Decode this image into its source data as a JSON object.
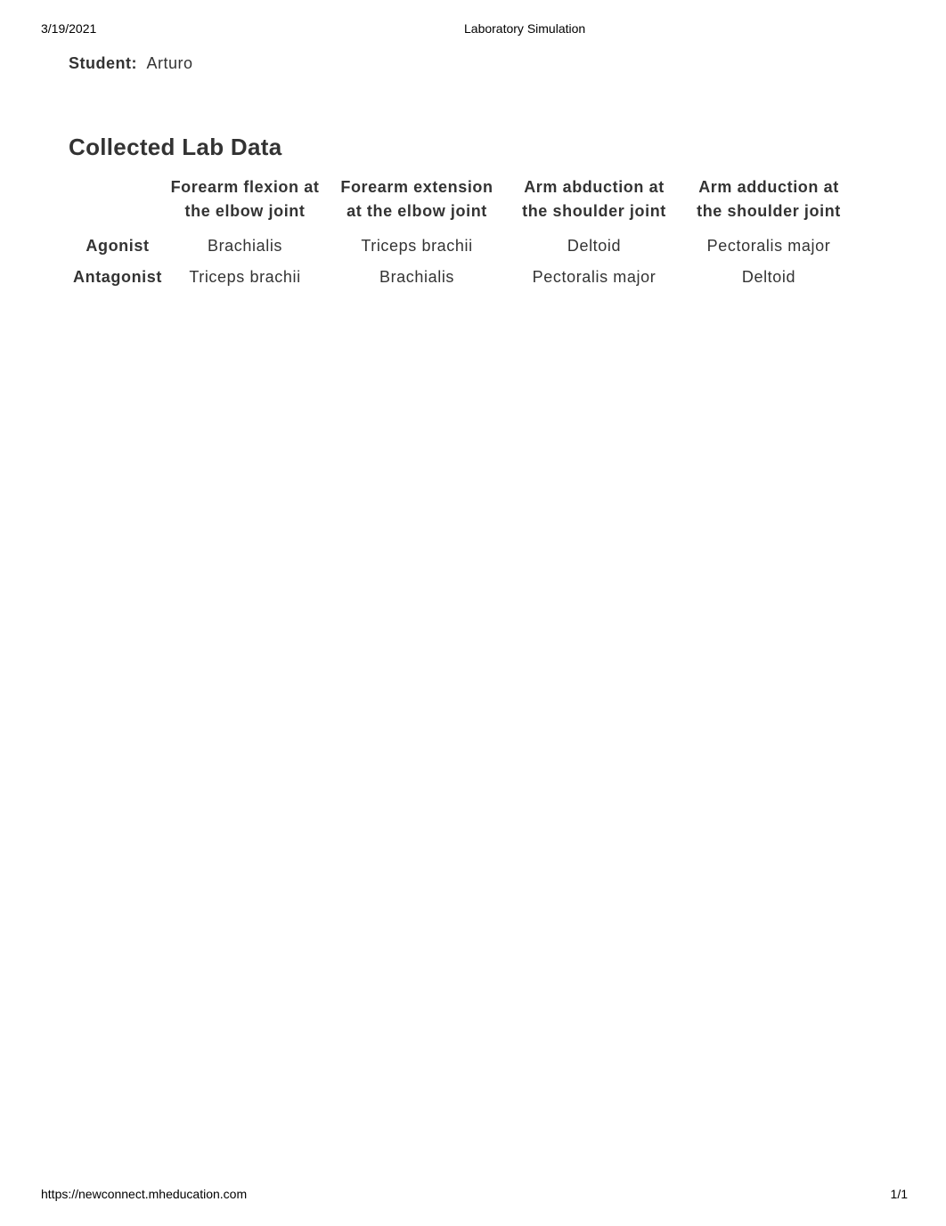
{
  "print_header": {
    "date": "3/19/2021",
    "title": "Laboratory Simulation"
  },
  "student": {
    "label": "Student:",
    "name": "Arturo"
  },
  "section_title": "Collected Lab Data",
  "table": {
    "columns": [
      "",
      "Forearm flexion at the elbow joint",
      "Forearm extension at the elbow joint",
      "Arm abduction at the shoulder joint",
      "Arm adduction at the shoulder joint"
    ],
    "columns_lines": [
      [
        "",
        ""
      ],
      [
        "Forearm flexion at",
        "the elbow joint"
      ],
      [
        "Forearm extension",
        "at the elbow joint"
      ],
      [
        "Arm abduction at",
        "the shoulder joint"
      ],
      [
        "Arm adduction at",
        "the shoulder joint"
      ]
    ],
    "rows": [
      {
        "label": "Agonist",
        "cells": [
          "Brachialis",
          "Triceps brachii",
          "Deltoid",
          "Pectoralis major"
        ]
      },
      {
        "label": "Antagonist",
        "cells": [
          "Triceps brachii",
          "Brachialis",
          "Pectoralis major",
          "Deltoid"
        ]
      }
    ]
  },
  "print_footer": {
    "url": "https://newconnect.mheducation.com",
    "page": "1/1"
  }
}
